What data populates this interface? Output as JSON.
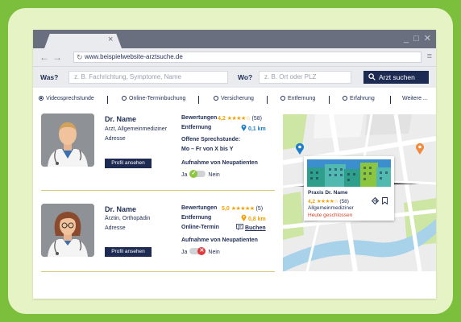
{
  "browser": {
    "tab_close": "×",
    "window_controls": [
      "_",
      "□",
      "✕"
    ],
    "nav_back": "←",
    "nav_forward": "→",
    "reload": "↻",
    "url": "www.beispielwebsite-arztsuche.de",
    "menu_icon": "≡"
  },
  "search": {
    "what_label": "Was?",
    "what_placeholder": "z. B. Fachrichtung, Symptome, Name",
    "where_label": "Wo?",
    "where_placeholder": "z. B. Ort oder PLZ",
    "button_label": "Arzt suchen"
  },
  "filters": [
    {
      "label": "Videosprechstunde",
      "selected": true
    },
    {
      "label": "Online-Terminbuchung",
      "selected": false
    },
    {
      "label": "Versicherung",
      "selected": false
    },
    {
      "label": "Entfernung",
      "selected": false
    },
    {
      "label": "Erfahrung",
      "selected": false
    },
    {
      "label": "Weitere ...",
      "selected": false
    }
  ],
  "doctors": [
    {
      "name": "Dr. Name",
      "specialty": "Arzt, Allgemeinmediziner",
      "address": "Adresse",
      "profile_button": "Profil ansehen",
      "ratings_label": "Bewertungen",
      "rating": "4,2",
      "stars": "★★★★☆",
      "review_count": "(58)",
      "distance_label": "Entfernung",
      "distance": "0,1 km",
      "hours_label": "Offene Sprechstunde:",
      "hours": "Mo – Fr von X bis  Y",
      "new_patients_label": "Aufnahme von Neupatienten",
      "yes": "Ja",
      "no": "Nein",
      "accepting": true
    },
    {
      "name": "Dr. Name",
      "specialty": "Ärztin, Orthopädin",
      "address": "Adresse",
      "profile_button": "Profil ansehen",
      "ratings_label": "Bewertungen",
      "rating": "5,0",
      "stars": "★★★★★",
      "review_count": "(5)",
      "distance_label": "Entfernung",
      "distance": "0,8 km",
      "online_label": "Online-Termin",
      "book_label": "Buchen",
      "new_patients_label": "Aufnahme von Neupatienten",
      "yes": "Ja",
      "no": "Nein",
      "accepting": false
    }
  ],
  "map_popup": {
    "name": "Praxis Dr. Name",
    "rating": "4,2",
    "stars": "★★★★☆",
    "review_count": "(58)",
    "specialty": "Allgemeinmediziner",
    "status": "Heute geschlossen"
  },
  "colors": {
    "navy": "#1d2b53",
    "blue_pin": "#1d7ec7",
    "orange_pin": "#f5a000",
    "green": "#7cbf3c",
    "red": "#e03a3a"
  }
}
